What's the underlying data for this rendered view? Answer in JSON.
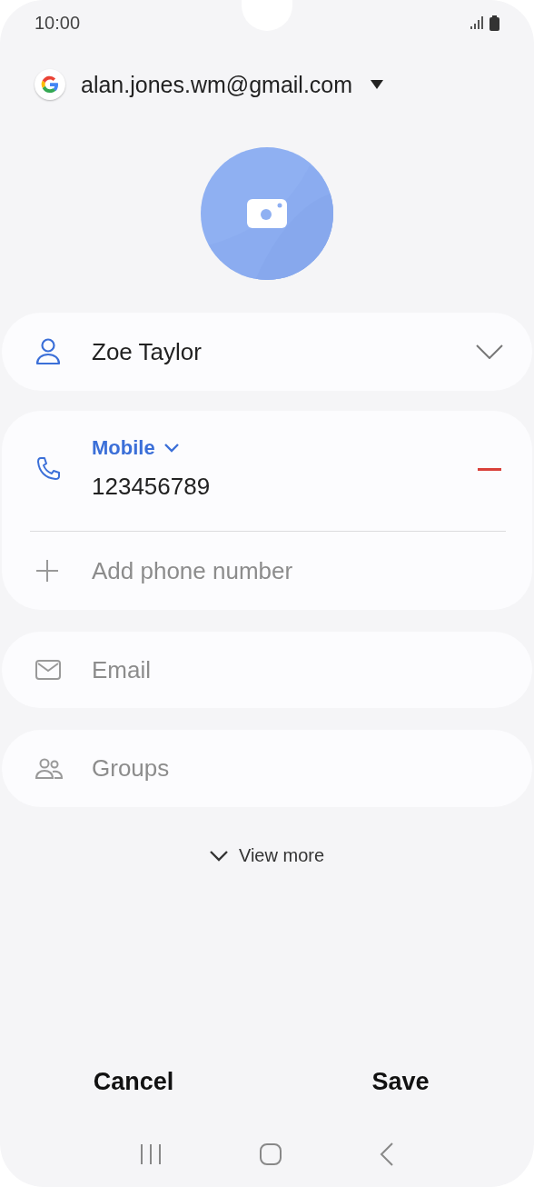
{
  "status_bar": {
    "time": "10:00"
  },
  "account": {
    "email": "alan.jones.wm@gmail.com"
  },
  "name": {
    "value": "Zoe Taylor"
  },
  "phone": {
    "type": "Mobile",
    "value": "123456789",
    "add_label": "Add phone number"
  },
  "email": {
    "placeholder": "Email"
  },
  "groups": {
    "label": "Groups"
  },
  "view_more": "View more",
  "buttons": [
    "Cancel",
    "Save"
  ]
}
